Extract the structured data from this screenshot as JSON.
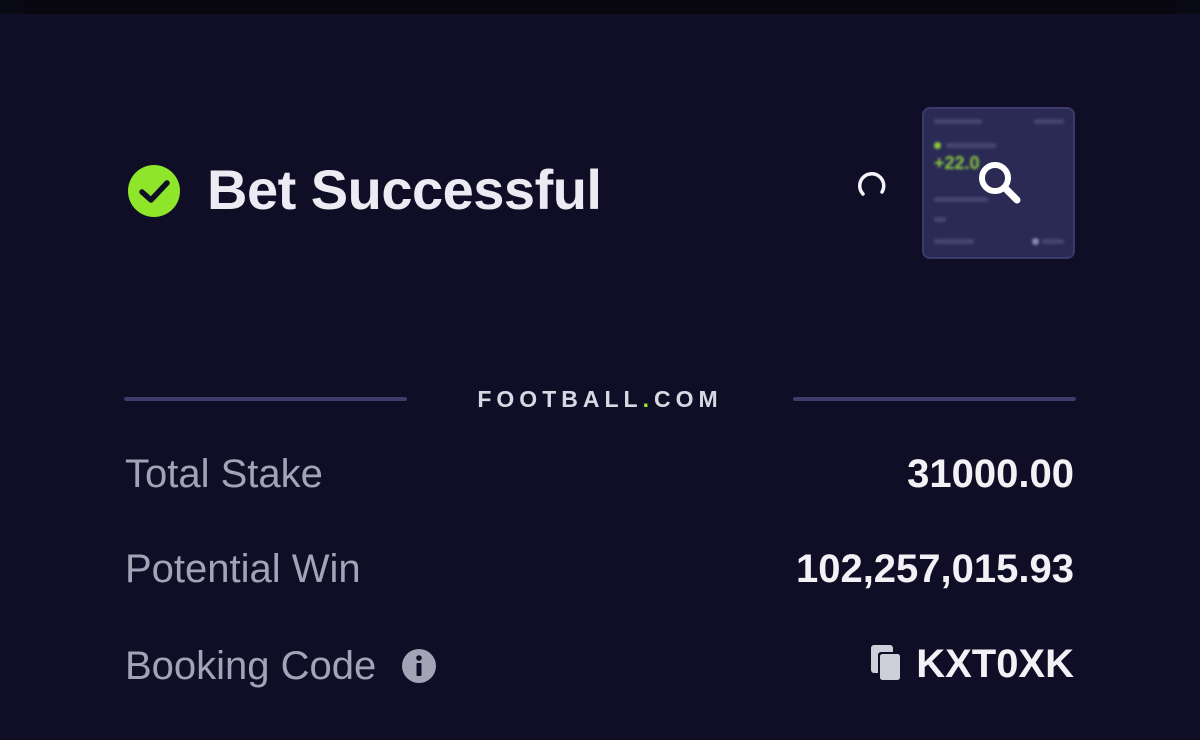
{
  "header": {
    "title": "Bet Successful",
    "status_icon": "check-circle-icon",
    "status_color": "#8fe52a"
  },
  "share_thumbnail": {
    "preview_amount": "+22.0"
  },
  "brand": {
    "name_before_dot": "FOOTBALL",
    "dot": ".",
    "name_after_dot": "COM",
    "accent_color": "#9de63a"
  },
  "summary": {
    "total_stake_label": "Total Stake",
    "total_stake_value": "31000.00",
    "potential_win_label": "Potential Win",
    "potential_win_value": "102,257,015.93",
    "booking_code_label": "Booking Code",
    "booking_code_value": "KXT0XK"
  },
  "icons": {
    "loading": "spinner-icon",
    "zoom": "magnifier-icon",
    "info": "info-icon",
    "copy": "copy-icon"
  }
}
